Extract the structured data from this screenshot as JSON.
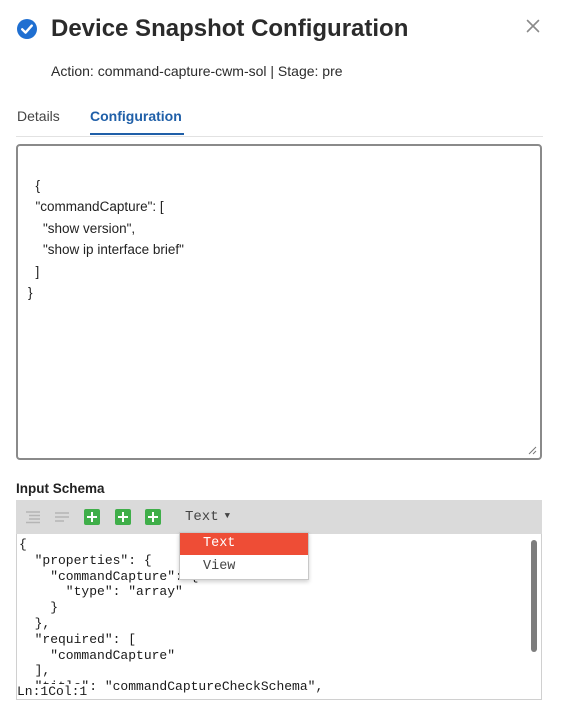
{
  "header": {
    "title": "Device Snapshot Configuration",
    "subtitle": "Action: command-capture-cwm-sol | Stage: pre",
    "accent_color": "#1f6fd1"
  },
  "tabs": [
    {
      "label": "Details",
      "active": false
    },
    {
      "label": "Configuration",
      "active": true
    }
  ],
  "configuration_text": "{\n  \"commandCapture\": [\n    \"show version\",\n    \"show ip interface brief\"\n  ]\n}",
  "input_schema": {
    "label": "Input Schema",
    "mode_selected": "Text",
    "mode_options": [
      "Text",
      "View"
    ],
    "code": "{\n  \"properties\": {\n    \"commandCapture\": {\n      \"type\": \"array\"\n    }\n  },\n  \"required\": [\n    \"commandCapture\"\n  ],\n  \"title\": \"commandCaptureCheckSchema\",",
    "status_line": "Ln:1",
    "status_col": "Col:1"
  },
  "icons": {
    "check": "check-circle-icon",
    "close": "close-icon",
    "format": "format-icon",
    "compact": "compact-icon",
    "add": "add-icon"
  },
  "colors": {
    "tab_active": "#1f5fa8",
    "add_button": "#3fae49",
    "dropdown_highlight": "#ee4d36"
  }
}
